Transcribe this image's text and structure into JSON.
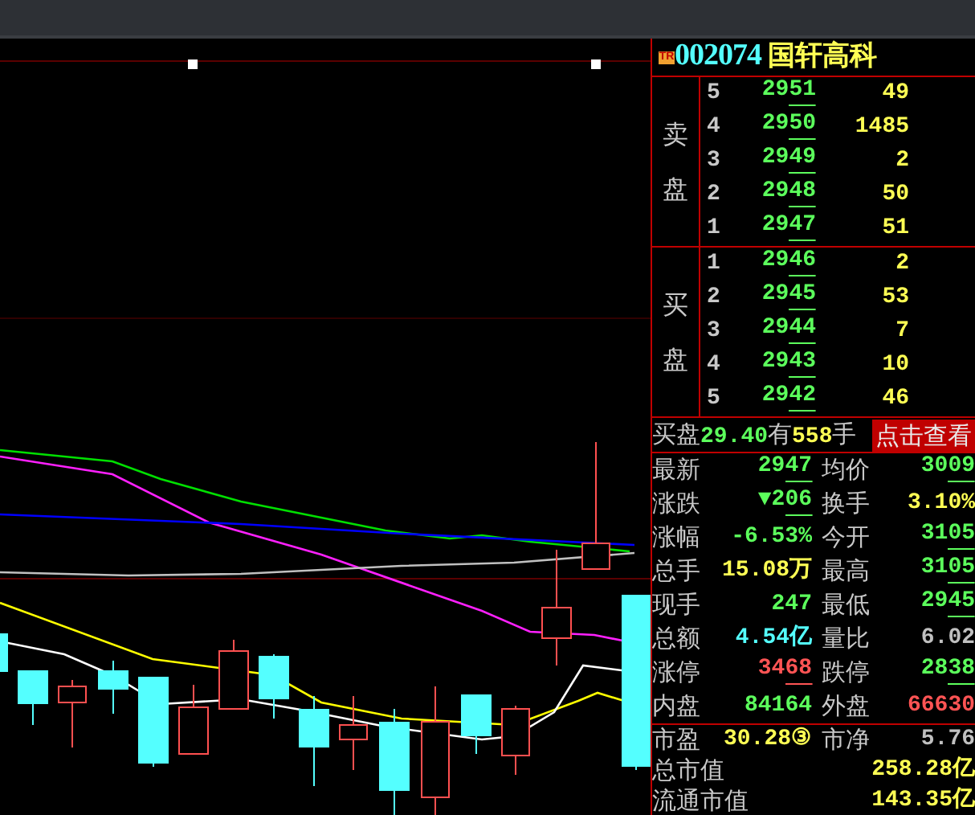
{
  "header": {
    "badge": "TR",
    "code": "002074",
    "name": "国轩高科"
  },
  "order_book": [
    {
      "side_label": "卖盘",
      "levels": [
        {
          "level": "5",
          "price": "2951",
          "volume": "49"
        },
        {
          "level": "4",
          "price": "2950",
          "volume": "1485"
        },
        {
          "level": "3",
          "price": "2949",
          "volume": "2"
        },
        {
          "level": "2",
          "price": "2948",
          "volume": "50"
        },
        {
          "level": "1",
          "price": "2947",
          "volume": "51"
        }
      ]
    },
    {
      "side_label": "买盘",
      "levels": [
        {
          "level": "1",
          "price": "2946",
          "volume": "2"
        },
        {
          "level": "2",
          "price": "2945",
          "volume": "53"
        },
        {
          "level": "3",
          "price": "2944",
          "volume": "7"
        },
        {
          "level": "4",
          "price": "2943",
          "volume": "10"
        },
        {
          "level": "5",
          "price": "2942",
          "volume": "46"
        }
      ]
    }
  ],
  "buy_queue": {
    "parts": [
      {
        "kind": "label",
        "text": "买盘"
      },
      {
        "kind": "price",
        "text": "29.40"
      },
      {
        "kind": "label",
        "text": "有"
      },
      {
        "kind": "volume",
        "text": "558"
      },
      {
        "kind": "label",
        "text": "手"
      }
    ],
    "button": "点击查看"
  },
  "quote": [
    [
      {
        "label": "最新",
        "value": "2947",
        "color": "#5cff5c",
        "underlined": true
      },
      {
        "label": "均价",
        "value": "3009",
        "color": "#5cff5c",
        "underlined": true
      }
    ],
    [
      {
        "label": "涨跌",
        "value": "▼206",
        "color": "#5cff5c",
        "underlined": true
      },
      {
        "label": "换手",
        "value": "3.10%",
        "color": "#ffff54",
        "underlined": false
      }
    ],
    [
      {
        "label": "涨幅",
        "value": "-6.53%",
        "color": "#5cff5c",
        "underlined": false
      },
      {
        "label": "今开",
        "value": "3105",
        "color": "#5cff5c",
        "underlined": true
      }
    ],
    [
      {
        "label": "总手",
        "value": "15.08万",
        "color": "#ffff54",
        "underlined": false
      },
      {
        "label": "最高",
        "value": "3105",
        "color": "#5cff5c",
        "underlined": true
      }
    ],
    [
      {
        "label": "现手",
        "value": "247",
        "color": "#5cff5c",
        "underlined": false
      },
      {
        "label": "最低",
        "value": "2945",
        "color": "#5cff5c",
        "underlined": true
      }
    ],
    [
      {
        "label": "总额",
        "value": "4.54亿",
        "color": "#54ffff",
        "underlined": false
      },
      {
        "label": "量比",
        "value": "6.02",
        "color": "#c0c0c0",
        "underlined": false
      }
    ],
    [
      {
        "label": "涨停",
        "value": "3468",
        "color": "#ff5454",
        "underlined": true
      },
      {
        "label": "跌停",
        "value": "2838",
        "color": "#5cff5c",
        "underlined": true
      }
    ],
    [
      {
        "label": "内盘",
        "value": "84164",
        "color": "#5cff5c",
        "underlined": false
      },
      {
        "label": "外盘",
        "value": "66630",
        "color": "#ff5454",
        "underlined": false
      }
    ]
  ],
  "valuation": [
    [
      {
        "label": "市盈",
        "value": "30.28③",
        "color": "#ffff54"
      },
      {
        "label": "市净",
        "value": "5.76",
        "color": "#c0c0c0"
      }
    ],
    [
      {
        "label": "总市值",
        "value": "258.28亿",
        "color": "#ffff54"
      }
    ],
    [
      {
        "label": "流通市值",
        "value": "143.35亿",
        "color": "#ffff54"
      }
    ]
  ]
}
